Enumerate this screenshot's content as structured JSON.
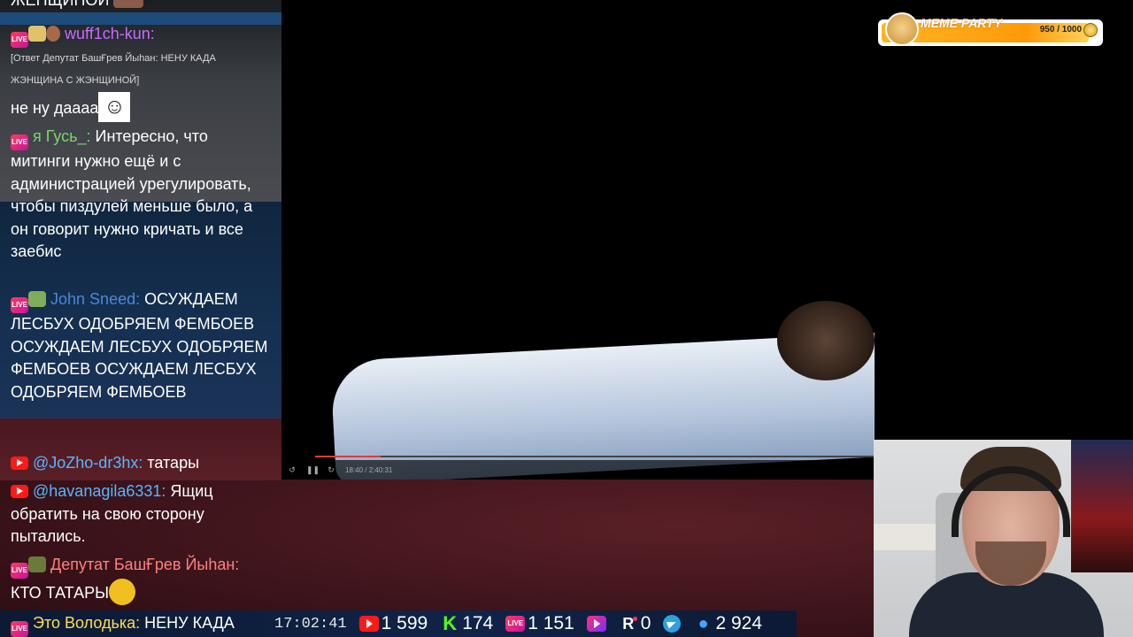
{
  "chat": {
    "messages": [
      {
        "user": "",
        "text": "ЖЕНЩИНОЙ",
        "color": "#ffffff"
      },
      {
        "platform": "live",
        "user": "wuff1ch-kun:",
        "user_color": "#c86bff",
        "reply": "[Ответ Депутат БашҒрев Йыһан: НЕНУ КАДА ЖЭНЩИНА С ЖЭНЩИНОЙ]",
        "text": "не ну даааа",
        "emote": "joker-emote"
      },
      {
        "platform": "live",
        "user": "я Гусь_:",
        "user_color": "#7bd66a",
        "text": "Интересно, что митинги нужно ещё и с администрацией урегулировать, чтобы пиздулей меньше было, а он говорит нужно кричать и все заебис"
      },
      {
        "platform": "live",
        "user": "John Sneed:",
        "user_color": "#4a88d8",
        "text": "ОСУЖДАЕМ ЛЕСБУХ ОДОБРЯЕМ ФЕМБОЕВ ОСУЖДАЕМ ЛЕСБУХ ОДОБРЯЕМ ФЕМБОЕВ ОСУЖДАЕМ ЛЕСБУХ ОДОБРЯЕМ ФЕМБОЕВ"
      },
      {
        "platform": "youtube",
        "user": "@JoZho-dr3hx:",
        "user_color": "#56b8ff",
        "text": "татары"
      },
      {
        "platform": "youtube",
        "user": "@havanagila6331:",
        "user_color": "#56b8ff",
        "text": "Ящиц обратить на свою сторону пытались."
      },
      {
        "platform": "live",
        "user": "Депутат БашҒрев Йыһан:",
        "user_color": "#ff8080",
        "text": "КТО ТАТАРЫ"
      }
    ],
    "ticker": {
      "user": "Это Володька:",
      "user_color": "#ffdd55",
      "text": "НЕНУ КАДА"
    }
  },
  "video": {
    "time": "18:40 / 2:40:31",
    "progress": 0.117
  },
  "meme_party": {
    "title": "MEME PARTY",
    "count": "950 / 1000",
    "progress": 0.95
  },
  "stats": {
    "clock": "17:02:41",
    "youtube": "1 599",
    "kick": "174",
    "live": "1 151",
    "vkplay": "",
    "rutube": "0",
    "telegram": "",
    "viewers": "2 924",
    "live_badge": "LIVE",
    "kick_letter": "K",
    "rutube_letter": "R"
  }
}
